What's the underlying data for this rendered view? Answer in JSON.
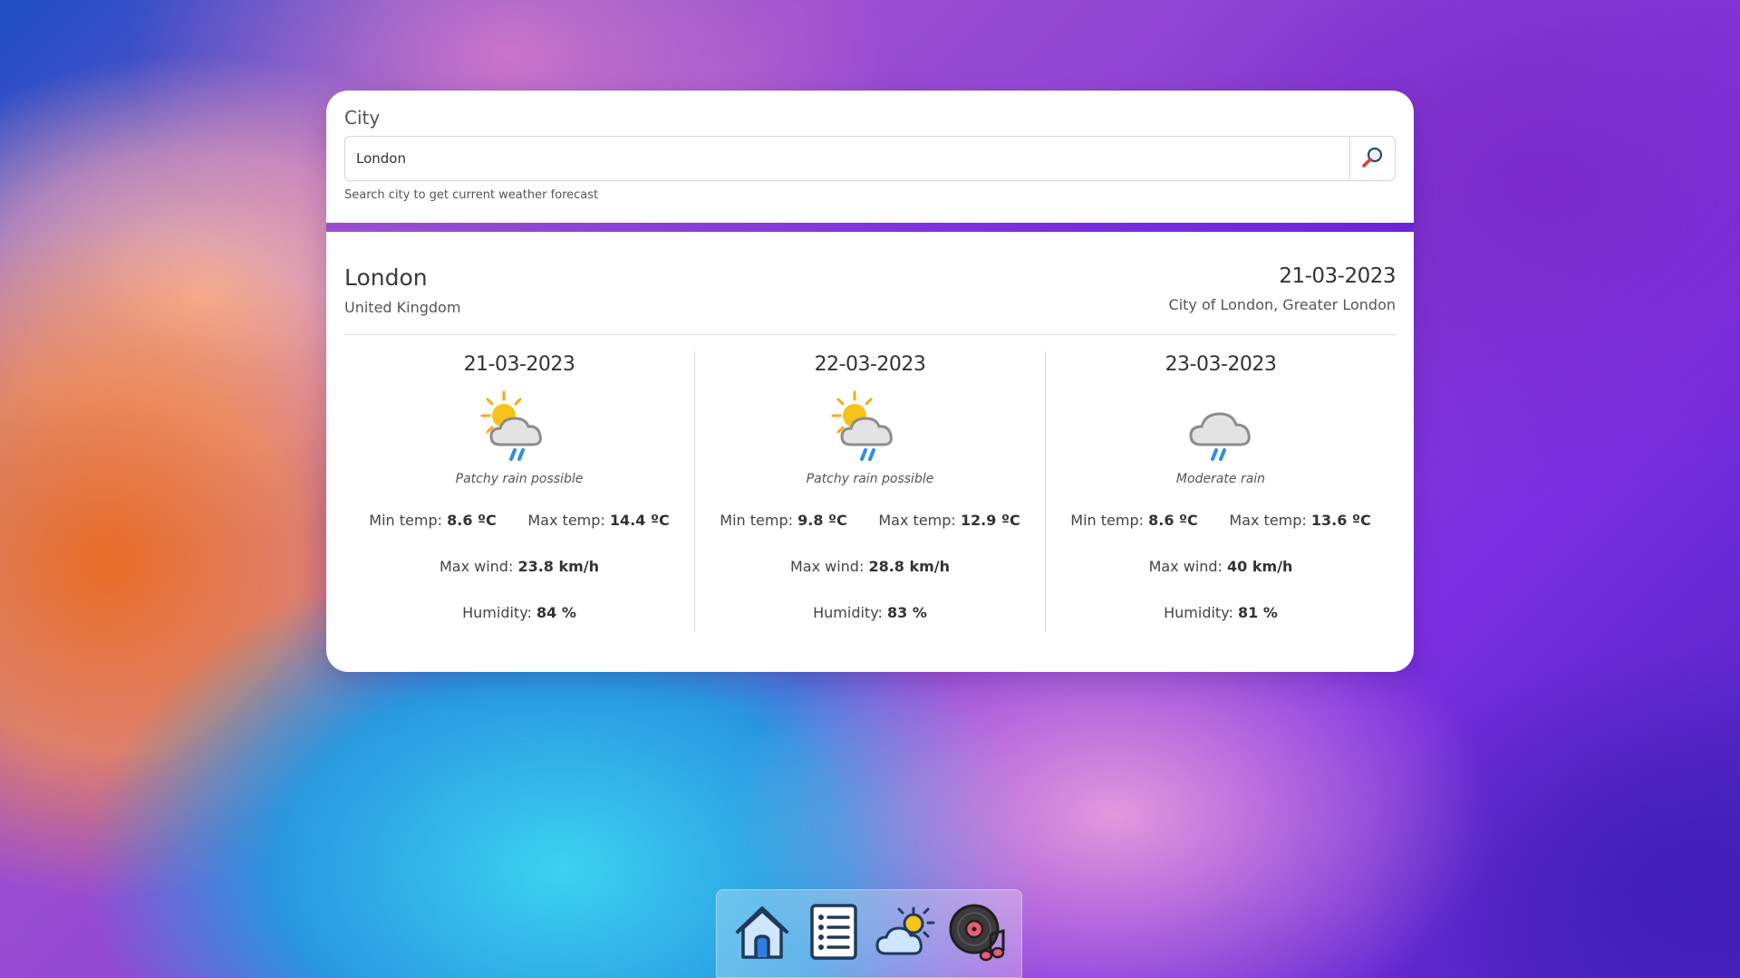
{
  "search": {
    "label": "City",
    "value": "London",
    "helper": "Search city to get current weather forecast",
    "button_icon": "search-icon"
  },
  "location": {
    "name": "London",
    "country": "United Kingdom",
    "date": "21-03-2023",
    "region": "City of London, Greater London"
  },
  "forecast": [
    {
      "date": "21-03-2023",
      "icon": "sun-cloud-rain-icon",
      "condition": "Patchy rain possible",
      "min_label": "Min temp:",
      "min_value": "8.6 ºC",
      "max_label": "Max temp:",
      "max_value": "14.4 ºC",
      "wind_label": "Max wind:",
      "wind_value": "23.8 km/h",
      "humidity_label": "Humidity:",
      "humidity_value": "84 %"
    },
    {
      "date": "22-03-2023",
      "icon": "sun-cloud-rain-icon",
      "condition": "Patchy rain possible",
      "min_label": "Min temp:",
      "min_value": "9.8 ºC",
      "max_label": "Max temp:",
      "max_value": "12.9 ºC",
      "wind_label": "Max wind:",
      "wind_value": "28.8 km/h",
      "humidity_label": "Humidity:",
      "humidity_value": "83 %"
    },
    {
      "date": "23-03-2023",
      "icon": "cloud-rain-icon",
      "condition": "Moderate rain",
      "min_label": "Min temp:",
      "min_value": "8.6 ºC",
      "max_label": "Max temp:",
      "max_value": "13.6 ºC",
      "wind_label": "Max wind:",
      "wind_value": "40 km/h",
      "humidity_label": "Humidity:",
      "humidity_value": "81 %"
    }
  ],
  "dock": {
    "items": [
      "home-icon",
      "notes-list-icon",
      "weather-icon",
      "music-disc-icon"
    ]
  },
  "colors": {
    "accent": "#7a2fe0",
    "rain_blue": "#2f8fe0",
    "sun_yellow": "#f7c21a"
  }
}
